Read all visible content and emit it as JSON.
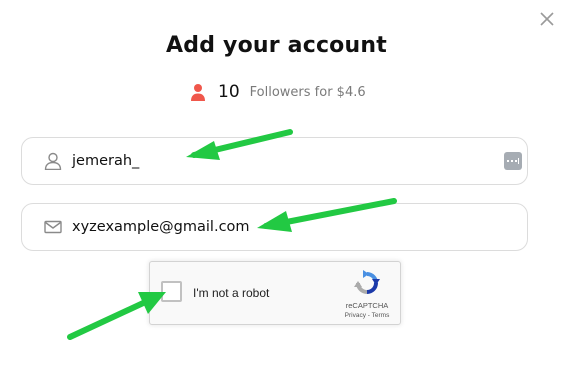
{
  "dialog": {
    "title": "Add your account",
    "close_icon": "close-icon"
  },
  "offer": {
    "icon": "user-icon",
    "icon_color": "#f0574b",
    "count": "10",
    "description": "Followers for $4.6"
  },
  "form": {
    "username": {
      "icon": "user-outline-icon",
      "value": "jemerah_"
    },
    "email": {
      "icon": "mail-icon",
      "value": "xyzexample@gmail.com"
    },
    "password_manager_icon": "password-manager-icon"
  },
  "recaptcha": {
    "label": "I'm not a robot",
    "brand": "reCAPTCHA",
    "links": "Privacy - Terms",
    "checked": false
  },
  "annotations": {
    "arrow_color": "#22c943"
  }
}
